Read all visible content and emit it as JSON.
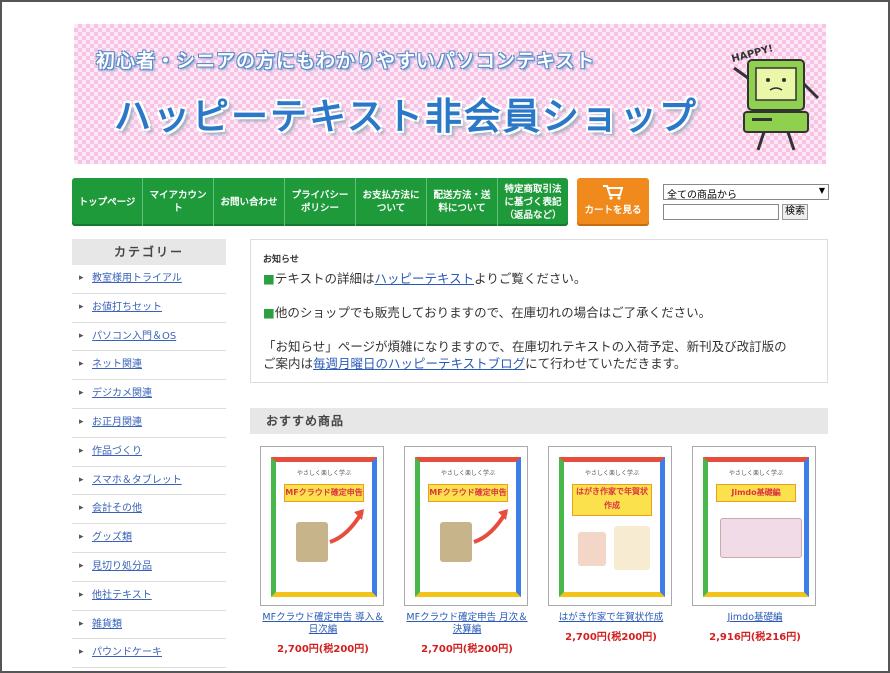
{
  "banner": {
    "subtitle": "初心者・シニアの方にもわかりやすいパソコンテキスト",
    "title": "ハッピーテキスト非会員ショップ",
    "mascot_text": "HAPPY!"
  },
  "nav": {
    "items": [
      "トップページ",
      "マイアカウント",
      "お問い合わせ",
      "プライバシーポリシー",
      "お支払方法について",
      "配送方法・送料について",
      "特定商取引法に基づく表記（返品など）"
    ]
  },
  "cart": {
    "label": "カートを見る"
  },
  "search": {
    "select_value": "全ての商品から",
    "input_value": "",
    "button_label": "検索"
  },
  "sidebar": {
    "heading": "カテゴリー",
    "items": [
      "教室様用トライアル",
      "お値打ちセット",
      "パソコン入門＆OS",
      "ネット関連",
      "デジカメ関連",
      "お正月関連",
      "作品づくり",
      "スマホ＆タブレット",
      "会計その他",
      "グッズ類",
      "見切り処分品",
      "他社テキスト",
      "雑貨類",
      "パウンドケーキ"
    ]
  },
  "notice": {
    "title": "お知らせ",
    "line1_pre": "テキストの詳細は",
    "line1_link": "ハッピーテキスト",
    "line1_post": "よりご覧ください。",
    "line2": "他のショップでも販売しておりますので、在庫切れの場合はご了承ください。",
    "line3a": "「お知らせ」ページが煩雑になりますので、在庫切れテキストの入荷予定、新刊及び改訂版の",
    "line3b_pre": "ご案内は",
    "line3b_link": "毎週月曜日のハッピーテキストブログ",
    "line3b_post": "にて行わせていただきます。"
  },
  "recommend": {
    "heading": "おすすめ商品",
    "products": [
      {
        "name": "MFクラウド確定申告 導入＆日次編",
        "price": "2,700円(税200円)",
        "cover_top": "やさしく楽しく学ぶ",
        "cover_title": "MFクラウド確定申告"
      },
      {
        "name": "MFクラウド確定申告 月次＆決算編",
        "price": "2,700円(税200円)",
        "cover_top": "やさしく楽しく学ぶ",
        "cover_title": "MFクラウド確定申告"
      },
      {
        "name": "はがき作家で年賀状作成",
        "price": "2,700円(税200円)",
        "cover_top": "やさしく楽しく学ぶ",
        "cover_title": "はがき作家で年賀状作成"
      },
      {
        "name": "Jimdo基礎編",
        "price": "2,916円(税216円)",
        "cover_top": "やさしく楽しく学ぶ",
        "cover_title": "Jimdo基礎編"
      }
    ]
  }
}
